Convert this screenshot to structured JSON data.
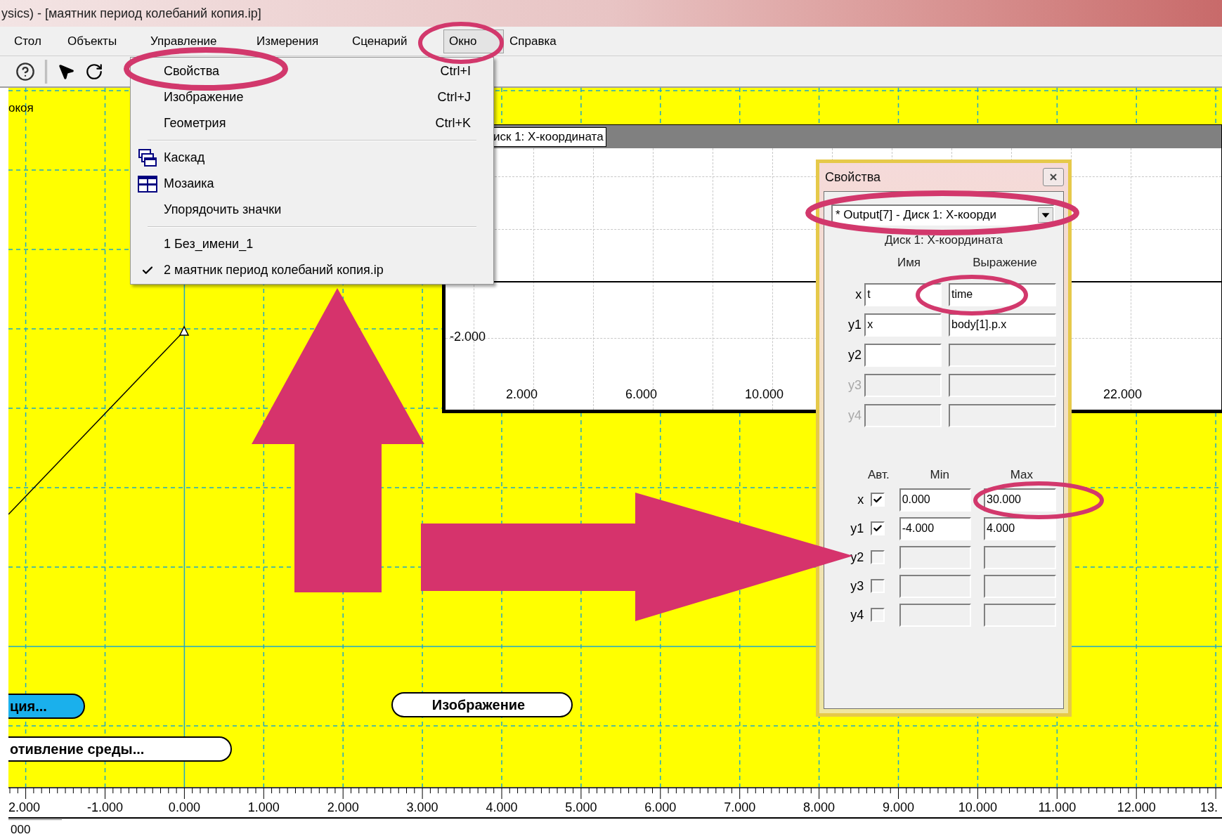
{
  "title_bar": {
    "title": "ysics) - [маятник период колебаний копия.ip]"
  },
  "menu_bar": [
    {
      "label": "Стол",
      "selected": false
    },
    {
      "label": "Объекты",
      "selected": false
    },
    {
      "label": "Управление",
      "selected": false
    },
    {
      "label": "Измерения",
      "selected": false
    },
    {
      "label": "Сценарий",
      "selected": false
    },
    {
      "label": "Окно",
      "selected": true
    },
    {
      "label": "Справка",
      "selected": false
    }
  ],
  "window_menu": {
    "items": [
      {
        "kind": "item",
        "label": "Свойства",
        "shortcut": "Ctrl+I",
        "checked": false
      },
      {
        "kind": "item",
        "label": "Изображение",
        "shortcut": "Ctrl+J",
        "checked": false
      },
      {
        "kind": "item",
        "label": "Геометрия",
        "shortcut": "Ctrl+K",
        "checked": false
      },
      {
        "kind": "separator"
      },
      {
        "kind": "cascade",
        "label": "Каскад",
        "checked": false
      },
      {
        "kind": "tile",
        "label": "Мозаика",
        "checked": false
      },
      {
        "kind": "item",
        "label": "Упорядочить значки",
        "checked": false
      },
      {
        "kind": "separator"
      },
      {
        "kind": "item",
        "label": "1 Без_имени_1",
        "checked": false
      },
      {
        "kind": "item",
        "label": "2 маятник период колебаний копия.ip",
        "checked": true
      }
    ]
  },
  "canvas": {
    "corner_label": "окоя",
    "buttons": [
      {
        "label": "ция...",
        "kind": "accent"
      },
      {
        "label": "Изображение",
        "kind": "plain"
      },
      {
        "label": "отивление среды...",
        "kind": "plain"
      }
    ],
    "ruler_labels": [
      "2.000",
      "-1.000",
      "0.000",
      "1.000",
      "2.000",
      "3.000",
      "4.000",
      "5.000",
      "6.000",
      "7.000",
      "8.000",
      "9.000",
      "10.000",
      "11.000",
      "12.000",
      "13."
    ],
    "bottom_label": "000"
  },
  "graph": {
    "tab_label": "иск 1: X-координата",
    "y_labels": [
      "-2.000"
    ],
    "x_labels": [
      "2.000",
      "6.000",
      "10.000",
      "22.000"
    ]
  },
  "dialog": {
    "title": "Свойства",
    "source_select": "* Output[7] - Диск 1: X-коорди",
    "subtitle": "Диск 1: X-координата",
    "name_header": "Имя",
    "expression_header": "Выражение",
    "rows": [
      {
        "label": "x",
        "name": "t",
        "expression": "time",
        "disabled": false,
        "expression_editable": true
      },
      {
        "label": "y1",
        "name": "x",
        "expression": "body[1].p.x",
        "disabled": false,
        "expression_editable": true
      },
      {
        "label": "y2",
        "disabled": false,
        "expression_editable": false
      },
      {
        "label": "y3",
        "disabled": true,
        "expression_editable": false
      },
      {
        "label": "y4",
        "disabled": true,
        "expression_editable": false
      }
    ],
    "auto_header": "Авт.",
    "min_header": "Min",
    "max_header": "Max",
    "ranges": [
      {
        "label": "x",
        "checked": true,
        "min": "0.000",
        "max": "30.000"
      },
      {
        "label": "y1",
        "checked": true,
        "min": "-4.000",
        "max": "4.000"
      },
      {
        "label": "y2",
        "checked": false
      },
      {
        "label": "y3",
        "checked": false
      },
      {
        "label": "y4",
        "checked": false
      }
    ]
  }
}
